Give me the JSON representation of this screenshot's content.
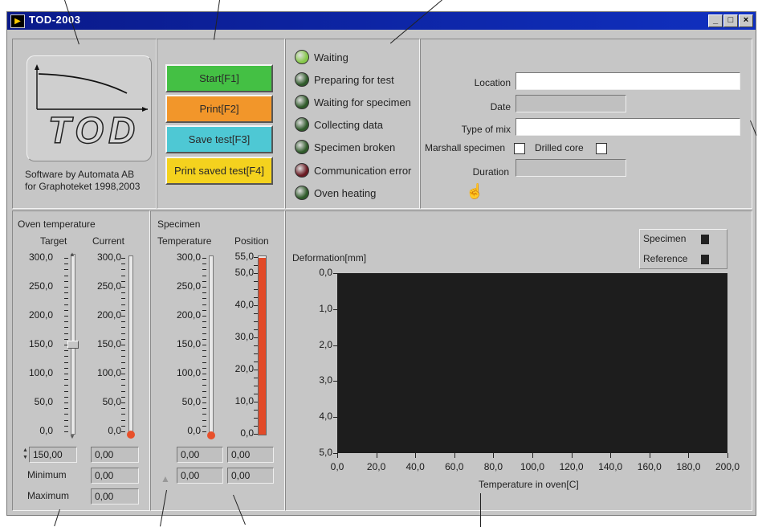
{
  "window": {
    "title": "TOD-2003"
  },
  "logo": {
    "text": "TOD",
    "credits_line1": "Software by Automata AB",
    "credits_line2": "for Graphoteket 1998,2003"
  },
  "buttons": [
    {
      "label": "Start[F1]",
      "color": "#44c044"
    },
    {
      "label": "Print[F2]",
      "color": "#f2962a"
    },
    {
      "label": "Save test[F3]",
      "color": "#4ec8d4"
    },
    {
      "label": "Print saved test[F4]",
      "color": "#f4d21e"
    }
  ],
  "status": [
    {
      "label": "Waiting",
      "color": "#86c84a"
    },
    {
      "label": "Preparing for test",
      "color": "#2f5a2a"
    },
    {
      "label": "Waiting for specimen",
      "color": "#2f5a2a"
    },
    {
      "label": "Collecting data",
      "color": "#2f5a2a"
    },
    {
      "label": "Specimen broken",
      "color": "#2f5a2a"
    },
    {
      "label": "Communication error",
      "color": "#6a1a22"
    },
    {
      "label": "Oven heating",
      "color": "#2f5a2a"
    }
  ],
  "info": {
    "location_label": "Location",
    "date_label": "Date",
    "mix_label": "Type of mix",
    "marshall_label": "Marshall specimen",
    "drilled_label": "Drilled core",
    "duration_label": "Duration"
  },
  "oven": {
    "title": "Oven temperature",
    "target_label": "Target",
    "current_label": "Current",
    "ticks": [
      "300,0",
      "250,0",
      "200,0",
      "150,0",
      "100,0",
      "50,0",
      "0,0"
    ],
    "target_value": "150,00",
    "current_value": "0,00",
    "minimum_label": "Minimum",
    "minimum_value": "0,00",
    "maximum_label": "Maximum",
    "maximum_value": "0,00"
  },
  "specimen": {
    "title": "Specimen",
    "temperature_label": "Temperature",
    "position_label": "Position",
    "temp_ticks": [
      "300,0",
      "250,0",
      "200,0",
      "150,0",
      "100,0",
      "50,0",
      "0,0"
    ],
    "pos_ticks": [
      "55,0",
      "50,0",
      "40,0",
      "30,0",
      "20,0",
      "10,0",
      "0,0"
    ],
    "temp_value1": "0,00",
    "pos_value1": "0,00",
    "temp_value2": "0,00",
    "pos_value2": "0,00"
  },
  "legend": {
    "specimen": "Specimen",
    "reference": "Reference"
  },
  "chart_data": {
    "type": "line",
    "ylabel": "Deformation[mm]",
    "xlabel": "Temperature in oven[C]",
    "xlim": [
      0,
      200
    ],
    "ylim": [
      5,
      0
    ],
    "x_ticks": [
      "0,0",
      "20,0",
      "40,0",
      "60,0",
      "80,0",
      "100,0",
      "120,0",
      "140,0",
      "160,0",
      "180,0",
      "200,0"
    ],
    "y_ticks": [
      "0,0",
      "1,0",
      "2,0",
      "3,0",
      "4,0",
      "5,0"
    ],
    "series": [
      {
        "name": "Specimen",
        "values": []
      },
      {
        "name": "Reference",
        "values": []
      }
    ]
  }
}
